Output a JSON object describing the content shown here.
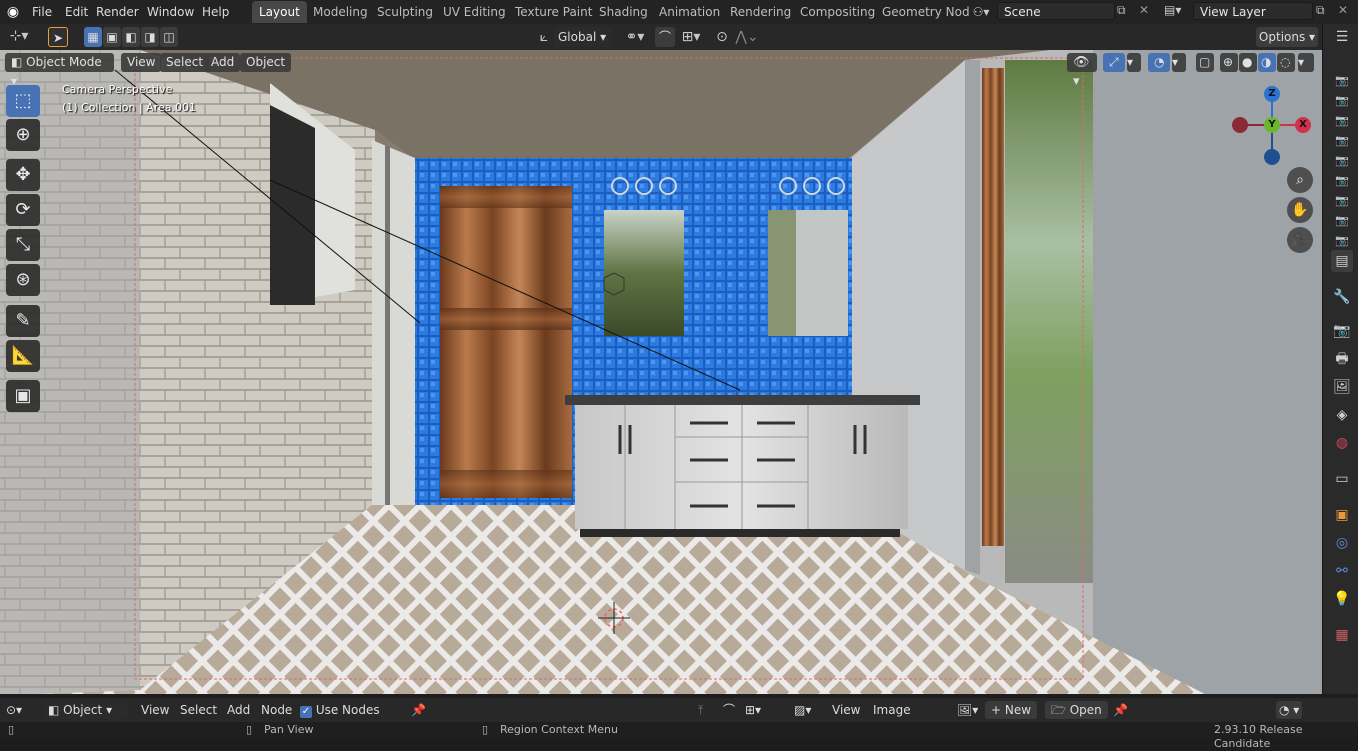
{
  "topbar": {
    "menus": [
      "File",
      "Edit",
      "Render",
      "Window",
      "Help"
    ],
    "workspaces": [
      "Layout",
      "Modeling",
      "Sculpting",
      "UV Editing",
      "Texture Paint",
      "Shading",
      "Animation",
      "Rendering",
      "Compositing",
      "Geometry Nod"
    ],
    "active_workspace": "Layout",
    "scene": "Scene",
    "view_layer": "View Layer"
  },
  "header": {
    "transform_orientation": "Global",
    "options_label": "Options"
  },
  "viewport": {
    "mode": "Object Mode",
    "menus": [
      "View",
      "Select",
      "Add",
      "Object"
    ],
    "overlay_title": "Camera Perspective",
    "overlay_subtitle": "(1) Collection | Area.001",
    "gizmo": {
      "z": "Z",
      "y": "Y",
      "x": "X"
    }
  },
  "bottom_editor": {
    "type": "Object",
    "menus": [
      "View",
      "Select",
      "Add",
      "Node"
    ],
    "use_nodes_label": "Use Nodes",
    "use_nodes_checked": true,
    "image_menus": [
      "View",
      "Image"
    ],
    "new_label": "New",
    "open_label": "Open"
  },
  "statusbar": {
    "pan": "Pan View",
    "context": "Region Context Menu",
    "version": "2.93.10 Release Candidate"
  },
  "colors": {
    "accent": "#4772b3",
    "tile_blue": "#1f6fd6",
    "axis_x": "#d3314a",
    "axis_y": "#6ab72d",
    "axis_z": "#2b72d3"
  }
}
